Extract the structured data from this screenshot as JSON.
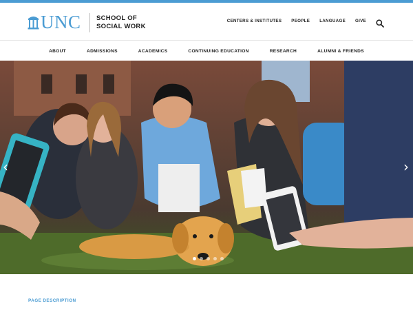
{
  "brand": {
    "logo_text": "UNC",
    "school_line1": "SCHOOL OF",
    "school_line2": "SOCIAL WORK",
    "accent_color": "#4b9cd3"
  },
  "utility_nav": [
    "CENTERS & INSTITUTES",
    "PEOPLE",
    "LANGUAGE",
    "GIVE"
  ],
  "search": {
    "icon": "search-icon"
  },
  "main_nav": [
    "ABOUT",
    "ADMISSIONS",
    "ACADEMICS",
    "CONTINUING EDUCATION",
    "RESEARCH",
    "ALUMNI & FRIENDS"
  ],
  "hero": {
    "prev_icon": "chevron-left-icon",
    "next_icon": "chevron-right-icon",
    "slide_count": 5,
    "active_slide": 1
  },
  "page_description": "PAGE DESCRIPTION"
}
